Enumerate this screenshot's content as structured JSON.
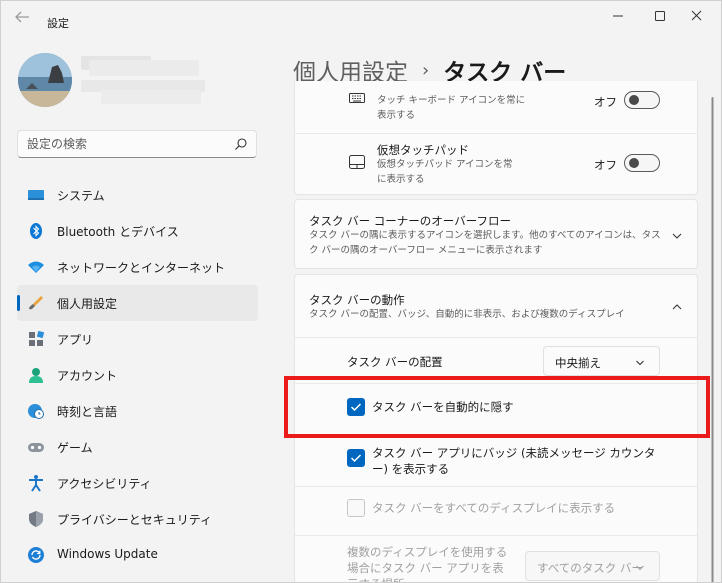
{
  "window": {
    "title": "設定"
  },
  "sidebar": {
    "search_placeholder": "設定の検索",
    "items": [
      {
        "label": "システム",
        "icon": "monitor-icon"
      },
      {
        "label": "Bluetooth とデバイス",
        "icon": "bluetooth-icon"
      },
      {
        "label": "ネットワークとインターネット",
        "icon": "wifi-icon"
      },
      {
        "label": "個人用設定",
        "icon": "brush-icon",
        "active": true
      },
      {
        "label": "アプリ",
        "icon": "apps-icon"
      },
      {
        "label": "アカウント",
        "icon": "person-icon"
      },
      {
        "label": "時刻と言語",
        "icon": "globe-clock-icon"
      },
      {
        "label": "ゲーム",
        "icon": "gamepad-icon"
      },
      {
        "label": "アクセシビリティ",
        "icon": "accessibility-icon"
      },
      {
        "label": "プライバシーとセキュリティ",
        "icon": "shield-icon"
      },
      {
        "label": "Windows Update",
        "icon": "update-icon"
      }
    ]
  },
  "header": {
    "parent": "個人用設定",
    "separator": "›",
    "current": "タスク バー"
  },
  "content": {
    "touch_keyboard": {
      "desc": "タッチ キーボード アイコンを常に\n表示する",
      "state_label": "オフ"
    },
    "virtual_touchpad": {
      "title": "仮想タッチパッド",
      "desc": "仮想タッチパッド アイコンを常\nに表示する",
      "state_label": "オフ"
    },
    "corner_overflow": {
      "title": "タスク バー コーナーのオーバーフロー",
      "desc": "タスク バーの隅に表示するアイコンを選択します。他のすべてのアイコンは、タスク バーの隅のオーバーフロー メニューに表示されます"
    },
    "behaviors": {
      "title": "タスク バーの動作",
      "desc": "タスク バーの配置、バッジ、自動的に非表示、および複数のディスプレイ",
      "alignment_label": "タスク バーの配置",
      "alignment_value": "中央揃え",
      "auto_hide_label": "タスク バーを自動的に隠す",
      "auto_hide_checked": true,
      "badges_label": "タスク バー アプリにバッジ (未読メッセージ カウンター) を表示する",
      "badges_checked": true,
      "all_displays_label": "タスク バーをすべてのディスプレイに表示する",
      "all_displays_checked": false,
      "multi_display_label": "複数のディスプレイを使用する場合にタスク バー アプリを表示する場所",
      "multi_display_value": "すべてのタスク バー"
    }
  },
  "colors": {
    "accent": "#0067c0",
    "highlight": "#ec1b1b"
  }
}
